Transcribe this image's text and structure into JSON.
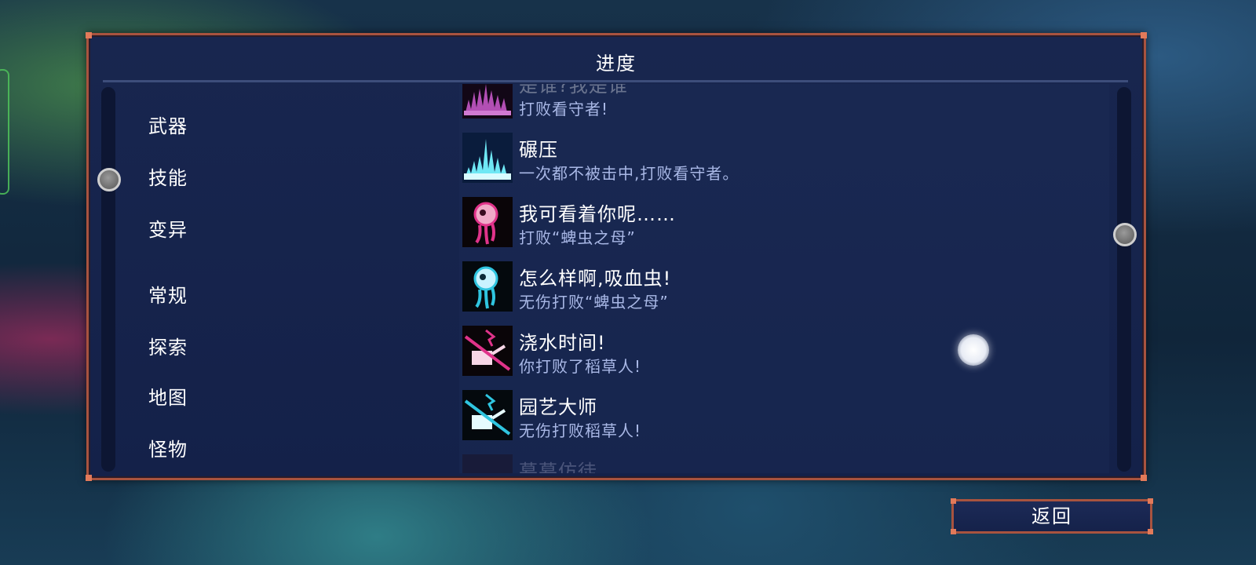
{
  "panel": {
    "title": "进度"
  },
  "categories": [
    {
      "label": "武器"
    },
    {
      "label": "技能"
    },
    {
      "label": "变异"
    },
    {
      "label": "常规"
    },
    {
      "label": "探索"
    },
    {
      "label": "地图"
    },
    {
      "label": "怪物"
    }
  ],
  "achievements": [
    {
      "title": "是谁?我是谁",
      "desc": "打败看守者!",
      "icon": "purple-spikes-icon"
    },
    {
      "title": "碾压",
      "desc": "一次都不被击中,打败看守者。",
      "icon": "cyan-spikes-icon"
    },
    {
      "title": "我可看着你呢……",
      "desc": "打败“蜱虫之母”",
      "icon": "pink-eye-monster-icon"
    },
    {
      "title": "怎么样啊,吸血虫!",
      "desc": "无伤打败“蜱虫之母”",
      "icon": "cyan-eye-monster-icon"
    },
    {
      "title": "浇水时间!",
      "desc": "你打败了稻草人!",
      "icon": "pink-watering-can-icon"
    },
    {
      "title": "园艺大师",
      "desc": "无伤打败稻草人!",
      "icon": "cyan-watering-can-icon"
    },
    {
      "title": "慕慕仿徒",
      "desc": "",
      "icon": "faded-icon"
    }
  ],
  "footer": {
    "back_label": "返回"
  },
  "colors": {
    "frame": "#a8533f",
    "panel": "#18264f",
    "desc_text": "#a9b8e6"
  }
}
